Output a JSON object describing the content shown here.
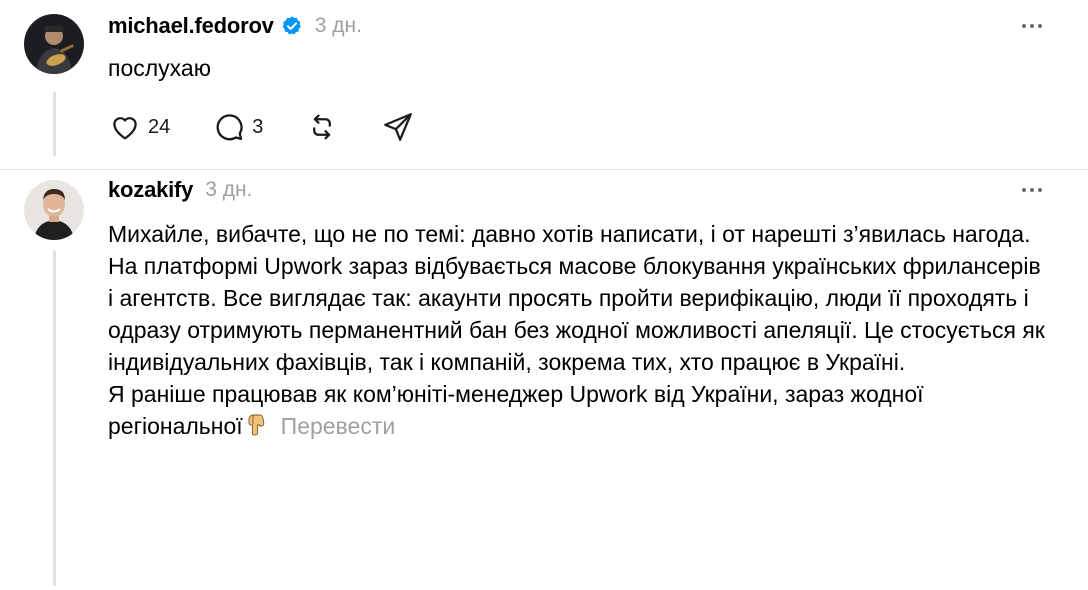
{
  "posts": [
    {
      "username": "michael.fedorov",
      "verified": true,
      "time": "3 дн.",
      "text": "послухаю",
      "actions": {
        "likes": "24",
        "replies": "3"
      },
      "icons": [
        "heart-icon",
        "comment-icon",
        "repost-icon",
        "share-icon",
        "verified-icon",
        "more-icon"
      ]
    },
    {
      "username": "kozakify",
      "time": "3 дн.",
      "paragraphs": [
        "Михайле, вибачте, що не по темі: давно хотів написати, і от нарешті з’явилась нагода.",
        "На платформі Upwork зараз відбувається масове блокування українських фрилансерів і агентств. Все виглядає так: акаунти просять пройти верифікацію, люди її проходять і одразу отримують перманентний бан без жодної можливості апеляції. Це стосується як індивідуальних фахівців, так і компаній, зокрема тих, хто працює в Україні.",
        "Я раніше працював як ком’юніті-менеджер Upwork від України, зараз жодної регіональної"
      ],
      "translate_label": "Перевести",
      "icons": [
        "pointing-down-hand-icon",
        "more-icon"
      ]
    }
  ],
  "colors": {
    "verified": "#0095f6",
    "muted": "#a0a0a0",
    "divider": "#e6e6e6"
  }
}
